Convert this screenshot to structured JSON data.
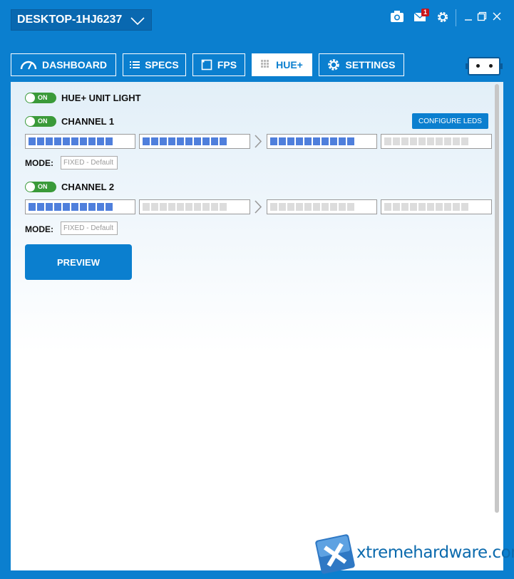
{
  "titlebar": {
    "device_name": "DESKTOP-1HJ6237",
    "notification_count": "1",
    "icons": [
      "camera-icon",
      "mail-icon",
      "gear-icon",
      "minimize-icon",
      "restore-icon",
      "close-icon"
    ]
  },
  "tabs": [
    {
      "label": "DASHBOARD",
      "icon": "speedometer-icon"
    },
    {
      "label": "SPECS",
      "icon": "list-icon"
    },
    {
      "label": "FPS",
      "icon": "square-icon"
    },
    {
      "label": "HUE+",
      "icon": "grid-icon",
      "active": true
    },
    {
      "label": "SETTINGS",
      "icon": "gear-icon"
    }
  ],
  "unit_light": {
    "toggle": "ON",
    "label": "HUE+ UNIT LIGHT"
  },
  "channel1": {
    "toggle": "ON",
    "label": "CHANNEL 1",
    "configure_label": "CONFIGURE LEDS",
    "strips_lit": [
      true,
      true,
      true,
      false
    ],
    "mode_label": "MODE:",
    "mode_value": "FIXED - Default"
  },
  "channel2": {
    "toggle": "ON",
    "label": "CHANNEL 2",
    "strips_lit": [
      true,
      false,
      false,
      false
    ],
    "mode_label": "MODE:",
    "mode_value": "FIXED - Default"
  },
  "preview_label": "PREVIEW",
  "watermark": "xtremehardware.com",
  "colors": {
    "accent": "#0b7fcf",
    "led_on": "#4f7fdc",
    "led_off": "#dcdcdc",
    "toggle_on": "#3a9a39"
  }
}
